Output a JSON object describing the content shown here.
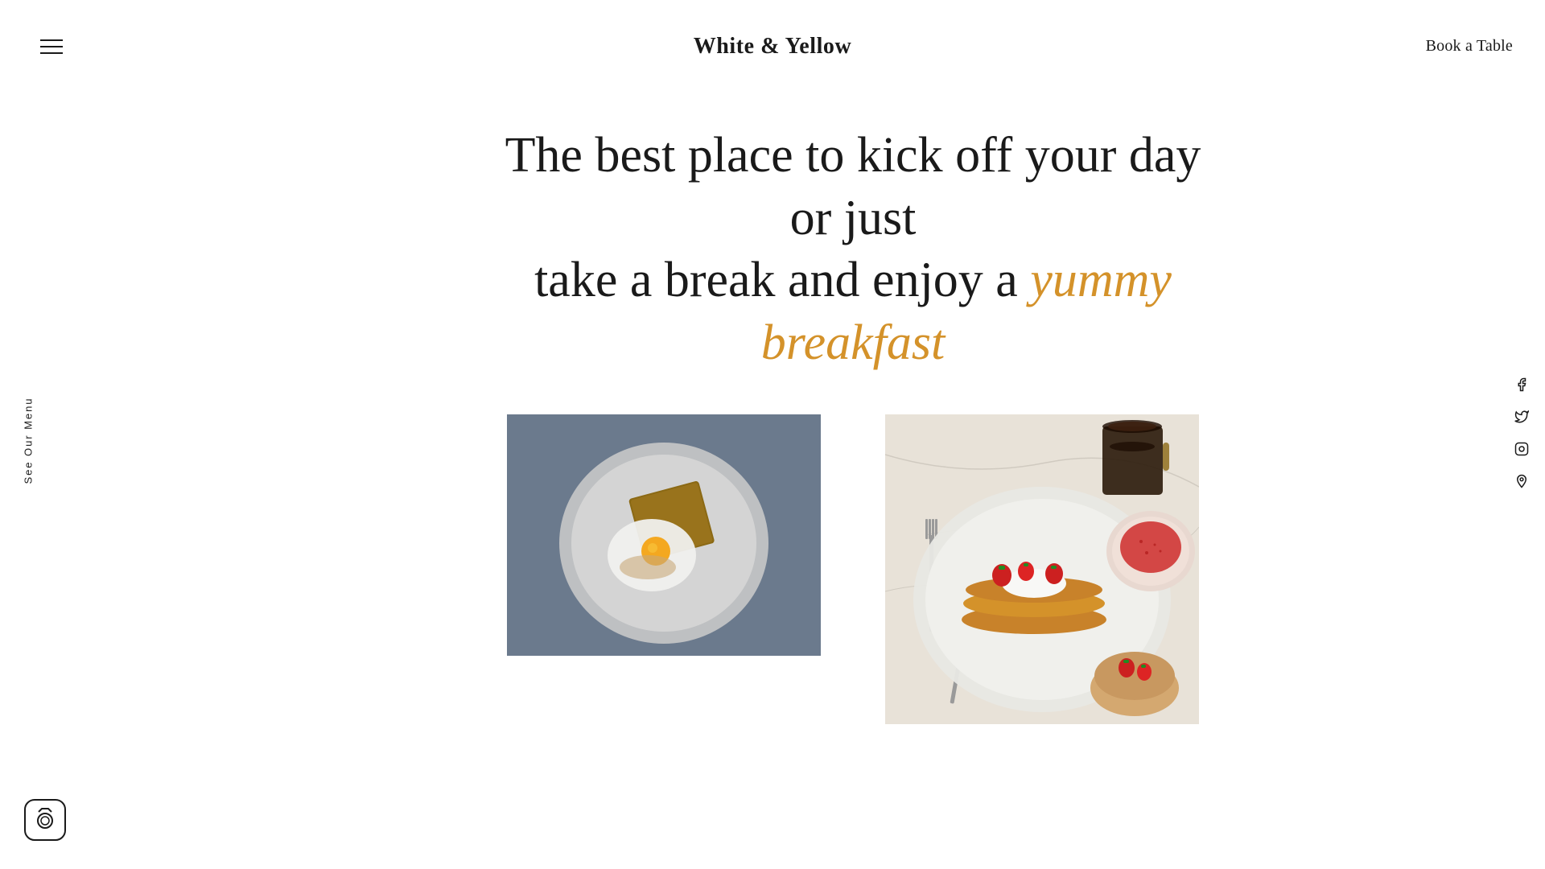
{
  "header": {
    "site_title": "White & Yellow",
    "book_table_label": "Book a Table"
  },
  "sidebar": {
    "menu_text": "See Our Menu"
  },
  "hero": {
    "line1": "The best place to kick off your day or just",
    "line2": "take a break and enjoy a ",
    "highlight": "yummy breakfast"
  },
  "social": {
    "icons": [
      {
        "name": "facebook",
        "symbol": "f"
      },
      {
        "name": "twitter",
        "symbol": "🐦"
      },
      {
        "name": "instagram",
        "symbol": "📷"
      },
      {
        "name": "foursquare",
        "symbol": "F"
      }
    ]
  },
  "colors": {
    "accent_gold": "#d4922a",
    "text_dark": "#1a1a1a",
    "background": "#ffffff"
  }
}
